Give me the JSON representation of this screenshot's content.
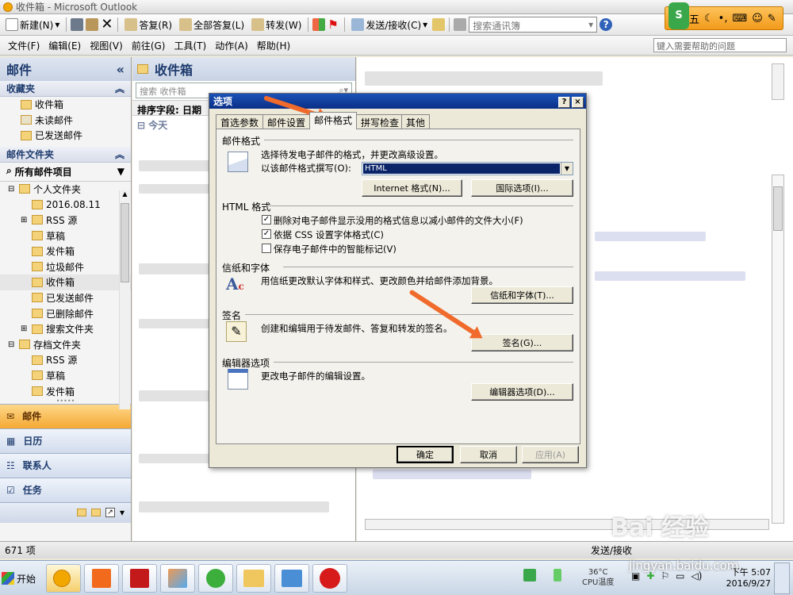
{
  "window": {
    "title": "收件箱 - Microsoft Outlook"
  },
  "toolbar": {
    "new": "新建(N)",
    "reply": "答复(R)",
    "reply_all": "全部答复(L)",
    "forward": "转发(W)",
    "send_receive": "发送/接收(C)",
    "search_contacts": "搜索通讯簿",
    "help_placeholder": "键入需要帮助的问题"
  },
  "menu": [
    "文件(F)",
    "编辑(E)",
    "视图(V)",
    "前往(G)",
    "工具(T)",
    "动作(A)",
    "帮助(H)"
  ],
  "nav": {
    "title": "邮件",
    "collapse": "«",
    "favorites_title": "收藏夹",
    "favorites": [
      "收件箱",
      "未读邮件",
      "已发送邮件"
    ],
    "folders_title": "邮件文件夹",
    "all_items": "所有邮件项目",
    "tree": [
      {
        "label": "个人文件夹",
        "lvl": 0,
        "exp": "⊟"
      },
      {
        "label": "2016.08.11",
        "lvl": 1,
        "exp": ""
      },
      {
        "label": "RSS 源",
        "lvl": 1,
        "exp": "⊞"
      },
      {
        "label": "草稿",
        "lvl": 1,
        "exp": ""
      },
      {
        "label": "发件箱",
        "lvl": 1,
        "exp": ""
      },
      {
        "label": "垃圾邮件",
        "lvl": 1,
        "exp": ""
      },
      {
        "label": "收件箱",
        "lvl": 1,
        "exp": ""
      },
      {
        "label": "已发送邮件",
        "lvl": 1,
        "exp": ""
      },
      {
        "label": "已删除邮件",
        "lvl": 1,
        "exp": ""
      },
      {
        "label": "搜索文件夹",
        "lvl": 1,
        "exp": "⊞"
      },
      {
        "label": "存档文件夹",
        "lvl": 0,
        "exp": "⊟"
      },
      {
        "label": "RSS 源",
        "lvl": 1,
        "exp": ""
      },
      {
        "label": "草稿",
        "lvl": 1,
        "exp": ""
      },
      {
        "label": "发件箱",
        "lvl": 1,
        "exp": ""
      }
    ],
    "buttons": [
      "邮件",
      "日历",
      "联系人",
      "任务"
    ]
  },
  "mid": {
    "title": "收件箱",
    "search_placeholder": "搜索 收件箱",
    "sort": "排序字段: 日期",
    "group": "今天"
  },
  "status": {
    "count": "671 项",
    "right": "发送/接收"
  },
  "taskbar": {
    "start": "开始",
    "cpu_temp": "36°C",
    "cpu_label": "CPU温度",
    "time": "下午 5:07",
    "date": "2016/9/27"
  },
  "watermark": {
    "site": "jingyan.baidu.com",
    "brand": "Bai 经验"
  },
  "ime": {
    "label": "五"
  },
  "dialog": {
    "title": "选项",
    "help": "?",
    "close": "×",
    "tabs": [
      "首选参数",
      "邮件设置",
      "邮件格式",
      "拼写检查",
      "其他"
    ],
    "selected_tab": 2,
    "format_group": "邮件格式",
    "format_desc": "选择待发电子邮件的格式，并更改高级设置。",
    "compose_label": "以该邮件格式撰写(O):",
    "compose_value": "HTML",
    "internet_btn": "Internet 格式(N)...",
    "intl_btn": "国际选项(I)...",
    "html_group": "HTML 格式",
    "chk1": "删除对电子邮件显示没用的格式信息以减小邮件的文件大小(F)",
    "chk2": "依据 CSS 设置字体格式(C)",
    "chk3": "保存电子邮件中的智能标记(V)",
    "chk_states": [
      true,
      true,
      false
    ],
    "stationery_group": "信纸和字体",
    "stationery_desc": "用信纸更改默认字体和样式、更改颜色并给邮件添加背景。",
    "stationery_btn": "信纸和字体(T)...",
    "sig_group": "签名",
    "sig_desc": "创建和编辑用于待发邮件、答复和转发的签名。",
    "sig_btn": "签名(G)...",
    "editor_group": "编辑器选项",
    "editor_desc": "更改电子邮件的编辑设置。",
    "editor_btn": "编辑器选项(D)...",
    "ok": "确定",
    "cancel": "取消",
    "apply": "应用(A)"
  }
}
